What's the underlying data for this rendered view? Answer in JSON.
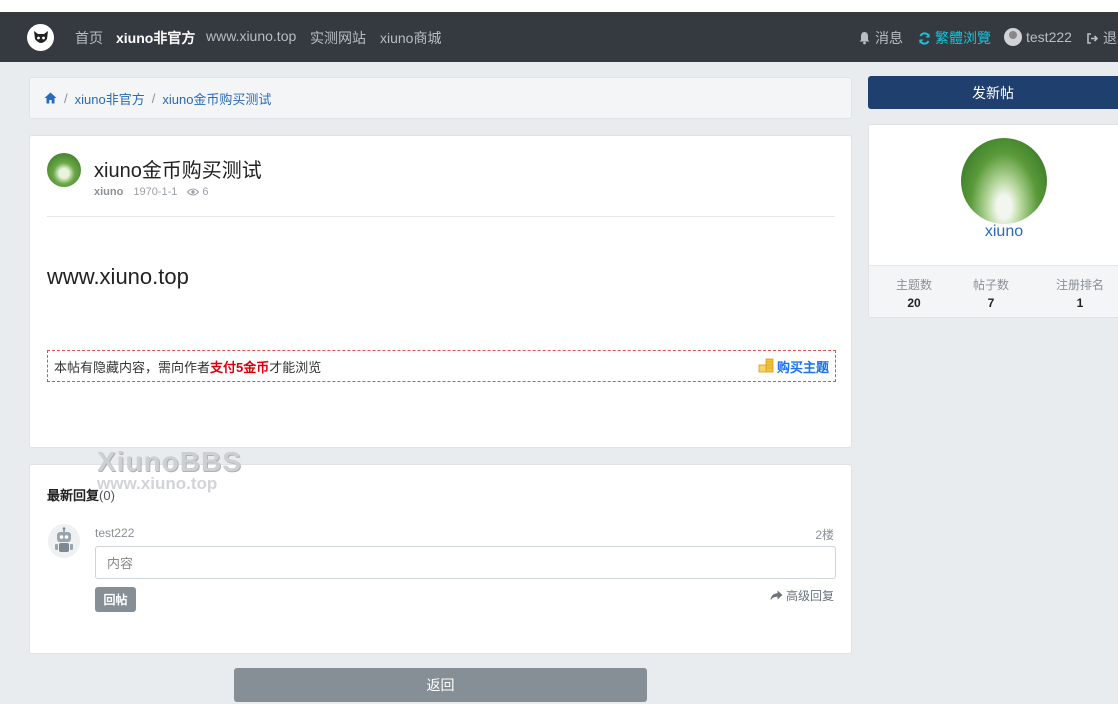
{
  "nav": {
    "links": [
      "首页",
      "xiuno非官方",
      "www.xiuno.top",
      "实测网站",
      "xiuno商城"
    ],
    "messages": "消息",
    "traditional": "繁體浏覽",
    "username": "test222",
    "logout": "退"
  },
  "breadcrumb": {
    "items": [
      "xiuno非官方",
      "xiuno金币购买测试"
    ],
    "separator": "/"
  },
  "post": {
    "title": "xiuno金币购买测试",
    "author": "xiuno",
    "date": "1970-1-1",
    "views": "6",
    "body": "www.xiuno.top",
    "hidden_prefix": "本帖有隐藏内容，需向作者",
    "hidden_pay": "支付5金币",
    "hidden_suffix": "才能浏览",
    "buy_label": "购买主题"
  },
  "watermark": {
    "line1": "XiunoBBS",
    "line2": "www.xiuno.top"
  },
  "replies": {
    "title": "最新回复",
    "count": "(0)",
    "user": "test222",
    "floor": "2楼",
    "placeholder": "内容",
    "submit": "回帖",
    "advanced": "高级回复"
  },
  "back_label": "返回",
  "sidebar": {
    "new_post": "发新帖",
    "username": "xiuno",
    "stats": [
      {
        "label": "主题数",
        "value": "20"
      },
      {
        "label": "帖子数",
        "value": "7"
      },
      {
        "label": "注册排名",
        "value": "1"
      }
    ]
  },
  "colors": {
    "navbar": "#343a40",
    "accent": "#1f3f6e",
    "link": "#2a6ab8",
    "pay_red": "#d9000a",
    "traditional_cyan": "#17c3d8"
  }
}
